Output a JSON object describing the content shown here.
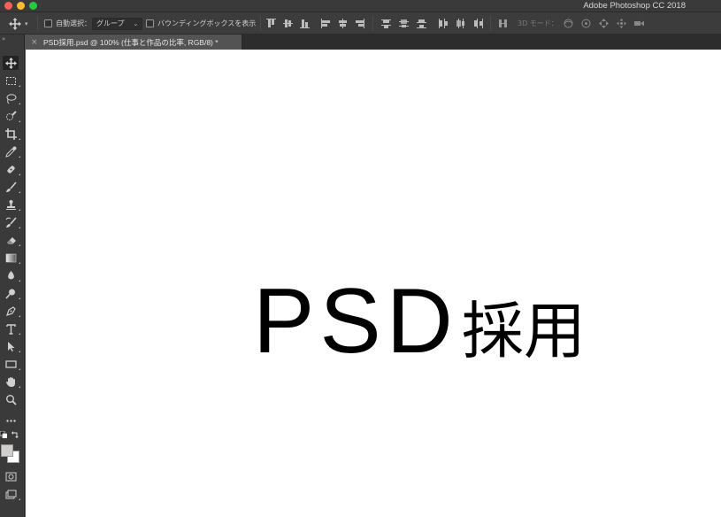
{
  "window": {
    "app_title": "Adobe Photoshop CC 2018"
  },
  "options_bar": {
    "tool_icon": "move-tool-icon",
    "auto_select_label": "自動選択：",
    "auto_select_checked": false,
    "auto_select_target": "グループ",
    "show_transform_label": "バウンディングボックスを表示",
    "show_transform_checked": false,
    "mode_3d_label": "3D モード："
  },
  "document": {
    "tab_title": "PSD採用.psd @ 100% (仕事と作品の比率, RGB/8) *",
    "canvas_text_latin": "PSD",
    "canvas_text_kanji": "採用",
    "background_color": "#ffffff",
    "text_color": "#000000"
  },
  "tools": [
    "move-tool-icon",
    "marquee-tool-icon",
    "lasso-tool-icon",
    "quick-select-tool-icon",
    "crop-tool-icon",
    "eyedropper-tool-icon",
    "healing-brush-tool-icon",
    "brush-tool-icon",
    "clone-stamp-tool-icon",
    "history-brush-tool-icon",
    "eraser-tool-icon",
    "gradient-tool-icon",
    "blur-tool-icon",
    "dodge-tool-icon",
    "pen-tool-icon",
    "type-tool-icon",
    "path-select-tool-icon",
    "rectangle-tool-icon",
    "hand-tool-icon",
    "zoom-tool-icon",
    "more-tools-icon"
  ],
  "colors": {
    "foreground": "#d0cfcd",
    "background": "#ffffff",
    "ui_dark": "#3a3a3a"
  }
}
